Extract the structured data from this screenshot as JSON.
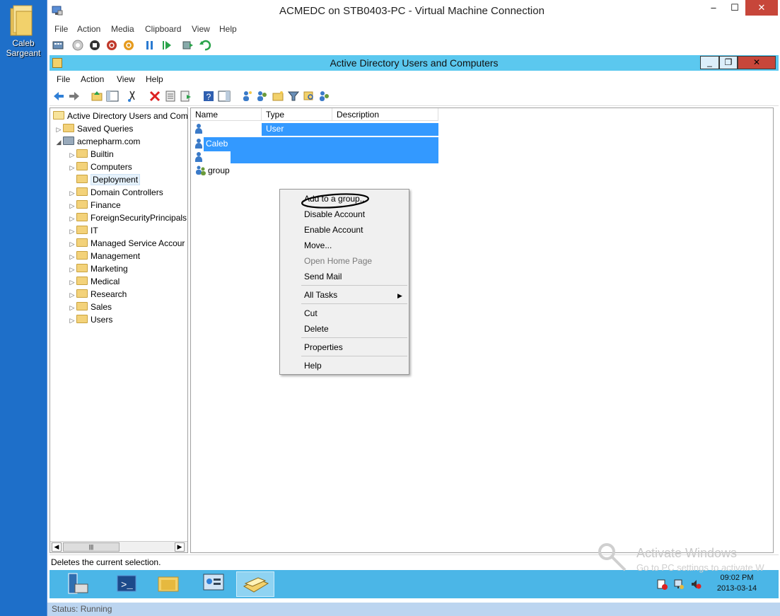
{
  "desktop": {
    "icon_label_line1": "Caleb",
    "icon_label_line2": "Sargeant"
  },
  "vm": {
    "title": "ACMEDC on STB0403-PC - Virtual Machine Connection",
    "menu": [
      "File",
      "Action",
      "Media",
      "Clipboard",
      "View",
      "Help"
    ],
    "status": "Status: Running"
  },
  "aduc": {
    "title": "Active Directory Users and Computers",
    "menu": [
      "File",
      "Action",
      "View",
      "Help"
    ],
    "tree": {
      "root": "Active Directory Users and Com",
      "saved_queries": "Saved Queries",
      "domain": "acmepharm.com",
      "ous": [
        "Builtin",
        "Computers",
        "Deployment",
        "Domain Controllers",
        "Finance",
        "ForeignSecurityPrincipals",
        "IT",
        "Managed Service Accour",
        "Management",
        "Marketing",
        "Medical",
        "Research",
        "Sales",
        "Users"
      ],
      "selected": "Deployment"
    },
    "columns": [
      "Name",
      "Type",
      "Description"
    ],
    "rows": [
      {
        "name": "",
        "type": "User",
        "icon": "user-icon"
      },
      {
        "name": "Caleb",
        "type": "",
        "icon": "user-icon"
      },
      {
        "name": "",
        "type": "",
        "icon": "user-icon"
      },
      {
        "name": "group",
        "type": "",
        "icon": "group-icon"
      }
    ],
    "context_menu": {
      "items": [
        {
          "label": "Add to a group...",
          "enabled": true
        },
        {
          "label": "Disable Account",
          "enabled": true
        },
        {
          "label": "Enable Account",
          "enabled": true
        },
        {
          "label": "Move...",
          "enabled": true
        },
        {
          "label": "Open Home Page",
          "enabled": false
        },
        {
          "label": "Send Mail",
          "enabled": true
        },
        {
          "label": "All Tasks",
          "enabled": true,
          "submenu": true
        },
        {
          "label": "Cut",
          "enabled": true
        },
        {
          "label": "Delete",
          "enabled": true
        },
        {
          "label": "Properties",
          "enabled": true
        },
        {
          "label": "Help",
          "enabled": true
        }
      ]
    },
    "statusbar": "Deletes the current selection."
  },
  "taskbar": {
    "time": "09:02 PM",
    "date": "2013-03-14"
  },
  "watermark": {
    "line1": "Activate Windows",
    "line2": "Go to PC settings to activate W"
  },
  "colors": {
    "accent": "#5bc8ef",
    "selection": "#3399ff",
    "desktop": "#1e6fc9"
  }
}
